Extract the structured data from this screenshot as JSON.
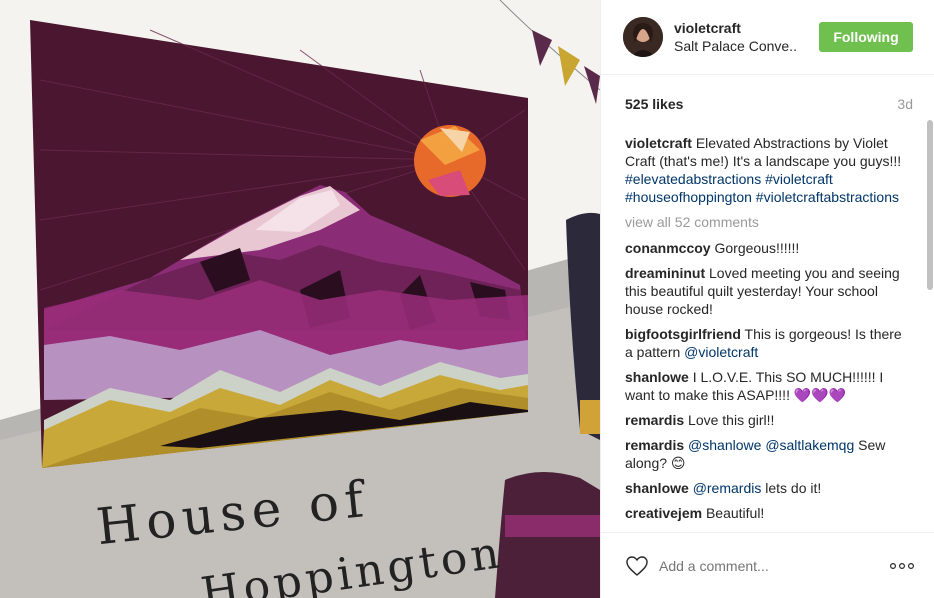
{
  "post": {
    "username": "violetcraft",
    "location": "Salt Palace Conve..",
    "follow_label": "Following",
    "likes": "525 likes",
    "time_ago": "3d",
    "caption_user": "violetcraft",
    "caption_text": "Elevated Abstractions by Violet Craft (that's me!) It's a landscape you guys!!! ",
    "caption_tags": [
      "#elevatedabstractions",
      "#violetcraft",
      "#houseofhoppington",
      "#violetcraftabstractions"
    ],
    "view_all": "view all 52 comments",
    "add_comment_placeholder": "Add a comment...",
    "colors": {
      "follow_bg": "#70c050",
      "link": "#003569",
      "muted": "#999999",
      "quilt": "#4a1630"
    }
  },
  "comments": [
    {
      "user": "conanmccoy",
      "text": "Gorgeous!!!!!!"
    },
    {
      "user": "dreamininut",
      "text": "Loved meeting you and seeing this beautiful quilt yesterday! Your school house rocked!"
    },
    {
      "user": "bigfootsgirlfriend",
      "text": "This is gorgeous! Is there a pattern ",
      "mention": "@violetcraft"
    },
    {
      "user": "shanlowe",
      "text": "I L.O.V.E. This SO MUCH!!!!!! I want to make this ASAP!!!! 💜💜💜"
    },
    {
      "user": "remardis",
      "text": "Love this girl!!"
    },
    {
      "user": "remardis",
      "mention": "@shanlowe",
      "mention2": "@saltlakemqg",
      "text": " Sew along? 😊"
    },
    {
      "user": "shanlowe",
      "mention": "@remardis",
      "text": " lets do it!"
    },
    {
      "user": "creativejem",
      "text": "Beautiful!"
    }
  ],
  "photo": {
    "sign_line1": "House of",
    "sign_line2": "Hoppington"
  }
}
